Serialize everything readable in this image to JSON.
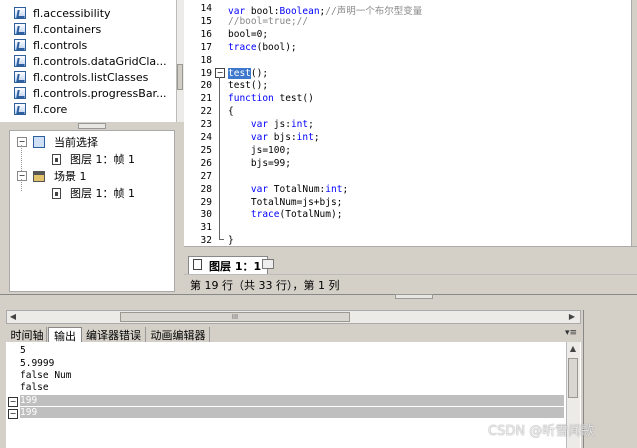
{
  "library": {
    "items": [
      {
        "label": "fl.accessibility"
      },
      {
        "label": "fl.containers"
      },
      {
        "label": "fl.controls"
      },
      {
        "label": "fl.controls.dataGridCla..."
      },
      {
        "label": "fl.controls.listClasses"
      },
      {
        "label": "fl.controls.progressBar..."
      },
      {
        "label": "fl.core"
      }
    ]
  },
  "scene_tree": {
    "current_selection": "当前选择",
    "current_layer": "图层 1：帧 1",
    "scene": "场景 1",
    "scene_layer": "图层 1：帧 1"
  },
  "editor": {
    "lines": [
      {
        "num": "14",
        "text": "var bool:Boolean;//声明一个布尔型变量"
      },
      {
        "num": "15",
        "text": "//bool=true;//"
      },
      {
        "num": "16",
        "text": "bool=0;"
      },
      {
        "num": "17",
        "text": "trace(bool);"
      },
      {
        "num": "18",
        "text": ""
      },
      {
        "num": "19",
        "text": "test();"
      },
      {
        "num": "20",
        "text": "test();"
      },
      {
        "num": "21",
        "text": "function test()"
      },
      {
        "num": "22",
        "text": "{"
      },
      {
        "num": "23",
        "text": "    var js:int;"
      },
      {
        "num": "24",
        "text": "    var bjs:int;"
      },
      {
        "num": "25",
        "text": "    js=100;"
      },
      {
        "num": "26",
        "text": "    bjs=99;"
      },
      {
        "num": "27",
        "text": ""
      },
      {
        "num": "28",
        "text": "    var TotalNum:int;"
      },
      {
        "num": "29",
        "text": "    TotalNum=js+bjs;"
      },
      {
        "num": "30",
        "text": "    trace(TotalNum);"
      },
      {
        "num": "31",
        "text": ""
      },
      {
        "num": "32",
        "text": "}"
      }
    ],
    "tab_label": "图层 1：1",
    "status": "第 19 行（共 33 行），第 1 列",
    "hscroll_label": "III"
  },
  "output_panel": {
    "tabs": [
      {
        "label": "时间轴"
      },
      {
        "label": "输出"
      },
      {
        "label": "编译器错误"
      },
      {
        "label": "动画编辑器"
      }
    ],
    "active_tab": "输出",
    "menu_icon": "panel-menu-icon",
    "lines": [
      "5",
      "5.9999",
      "false Num",
      "false",
      "199",
      "199"
    ]
  },
  "watermark": "CSDN @听雪闻歌",
  "colors": {
    "keyword": "#0000ff",
    "comment": "#888888",
    "selection": "#3d78cc",
    "output_selection": "#bfbfbf"
  }
}
